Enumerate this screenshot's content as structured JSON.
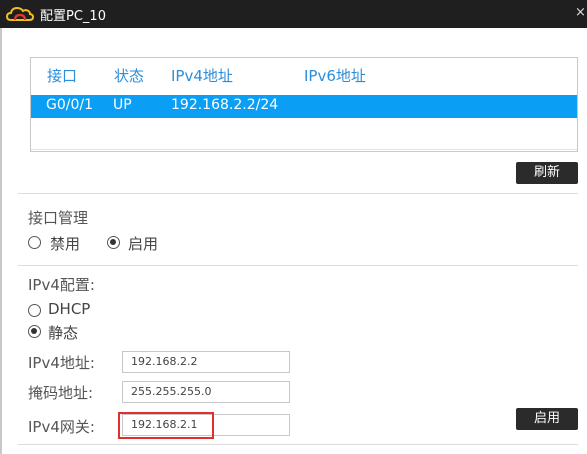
{
  "window": {
    "title": "配置PC_10",
    "close_glyph": "×",
    "icon": "cloud-icon"
  },
  "interfaces": {
    "headers": [
      "接口",
      "状态",
      "IPv4地址",
      "IPv6地址"
    ],
    "rows": [
      {
        "port": "G0/0/1",
        "status": "UP",
        "ipv4": "192.168.2.2/24",
        "ipv6": "",
        "selected": true
      }
    ],
    "refresh_label": "刷新"
  },
  "iface_mgmt": {
    "title": "接口管理",
    "options": [
      {
        "label": "禁用",
        "selected": false
      },
      {
        "label": "启用",
        "selected": true
      }
    ]
  },
  "ipv4_config": {
    "title": "IPv4配置:",
    "dhcp_label": "DHCP",
    "dhcp_selected": false,
    "static_label": "静态",
    "static_selected": true,
    "address_label": "IPv4地址:",
    "address_value": "192.168.2.2",
    "mask_label": "掩码地址:",
    "mask_value": "255.255.255.0",
    "gateway_label": "IPv4网关:",
    "gateway_value": "192.168.2.1",
    "apply_label": "启用"
  },
  "colors": {
    "header_text": "#2c8ed9",
    "selected_row": "#0a9ff5",
    "titlebar": "#1f1f1f",
    "highlight": "#e0302b"
  }
}
